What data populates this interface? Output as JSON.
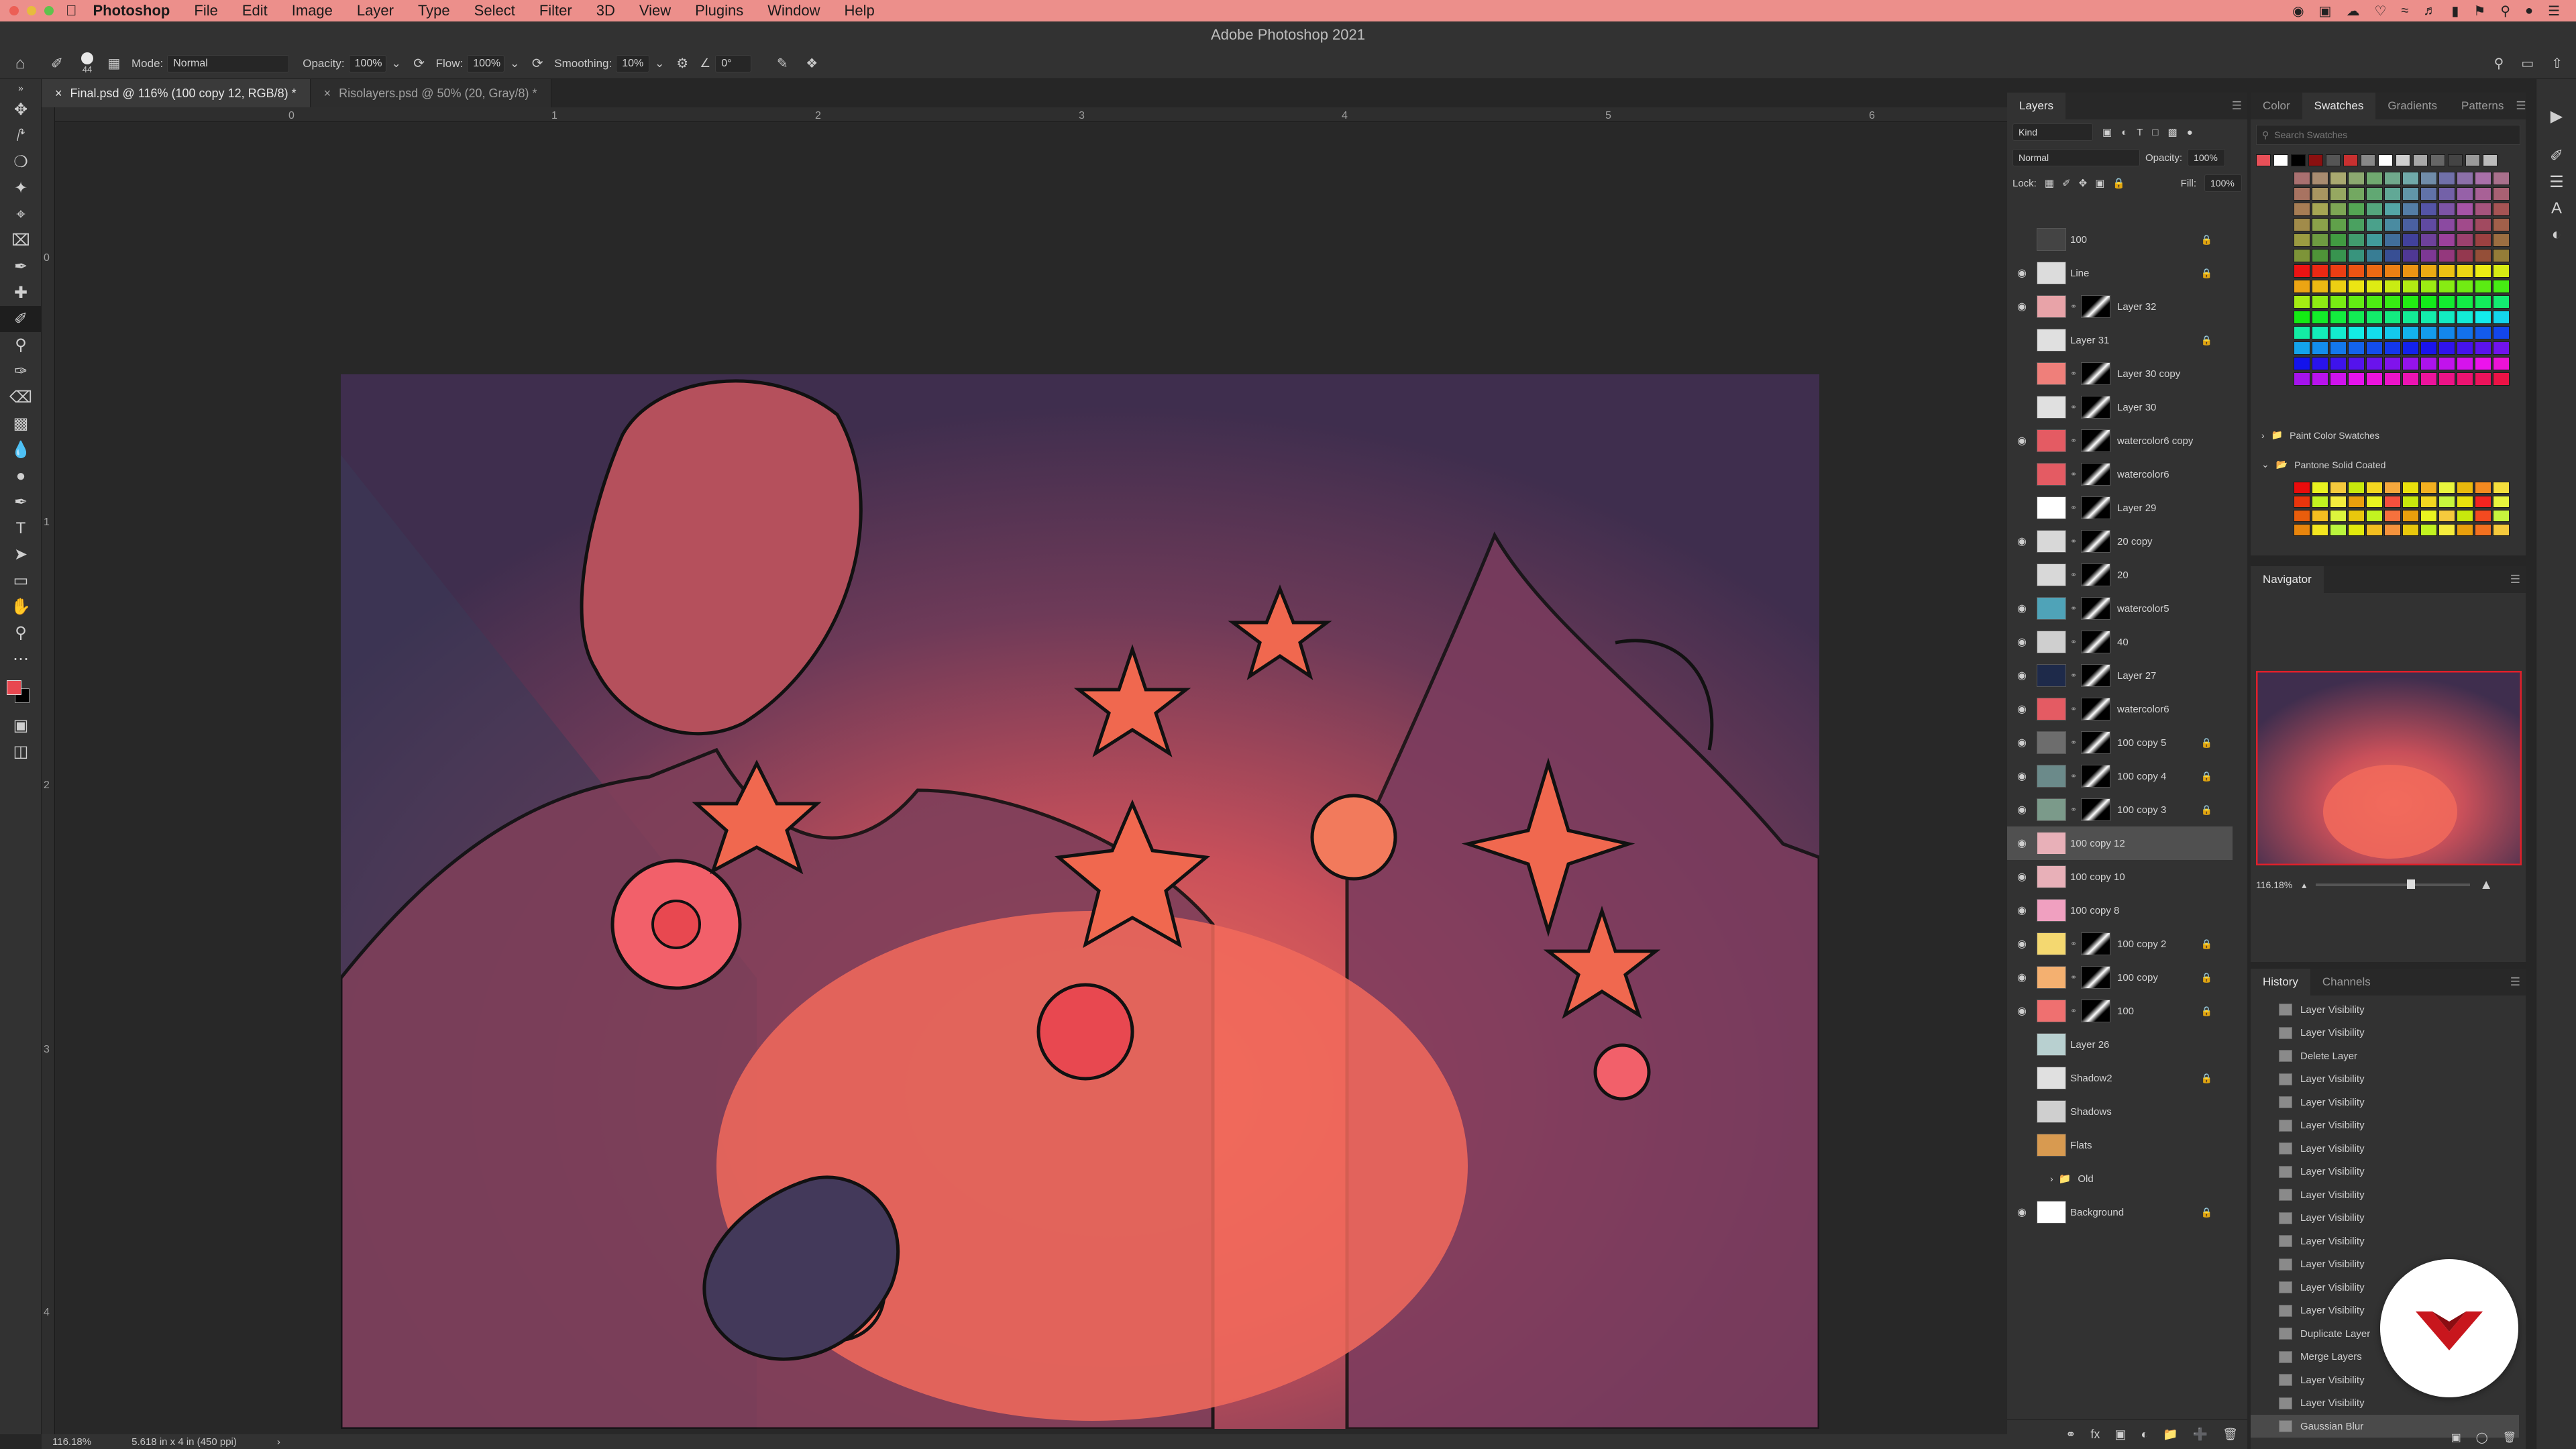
{
  "menubar": {
    "app": "Photoshop",
    "items": [
      "File",
      "Edit",
      "Image",
      "Layer",
      "Type",
      "Select",
      "Filter",
      "3D",
      "View",
      "Plugins",
      "Window",
      "Help"
    ]
  },
  "window_title": "Adobe Photoshop 2021",
  "options": {
    "brush_size": "44",
    "mode_label": "Mode:",
    "mode_value": "Normal",
    "opacity_label": "Opacity:",
    "opacity_value": "100%",
    "flow_label": "Flow:",
    "flow_value": "100%",
    "smoothing_label": "Smoothing:",
    "smoothing_value": "10%",
    "angle_value": "0°"
  },
  "tabs": [
    {
      "label": "Final.psd @ 116% (100 copy 12, RGB/8) *",
      "active": true
    },
    {
      "label": "Risolayers.psd @ 50% (20, Gray/8) *",
      "active": false
    }
  ],
  "rulers": {
    "h": [
      "0",
      "1",
      "2",
      "3",
      "4",
      "5",
      "6"
    ],
    "v": [
      "0",
      "1",
      "2",
      "3",
      "4"
    ]
  },
  "status": {
    "zoom": "116.18%",
    "doc_size": "5.618 in x 4 in (450 ppi)"
  },
  "layers_panel": {
    "tabs": [
      "Layers"
    ],
    "filter_kind": "Kind",
    "blend_mode": "Normal",
    "opacity_label": "Opacity:",
    "opacity_value": "100%",
    "lock_label": "Lock:",
    "fill_label": "Fill:",
    "fill_value": "100%",
    "layers": [
      {
        "name": "100",
        "visible": false,
        "locked": true,
        "thumb": "#444",
        "mask": false
      },
      {
        "name": "Line",
        "visible": true,
        "locked": true,
        "thumb": "#dcdcdc",
        "mask": false
      },
      {
        "name": "Layer 32",
        "visible": true,
        "locked": false,
        "thumb": "#e8a3a8",
        "mask": true
      },
      {
        "name": "Layer 31",
        "visible": false,
        "locked": true,
        "thumb": "#e0e0e0",
        "mask": false
      },
      {
        "name": "Layer 30 copy",
        "visible": false,
        "locked": false,
        "thumb": "#ef7f7a",
        "mask": true
      },
      {
        "name": "Layer 30",
        "visible": false,
        "locked": false,
        "thumb": "#e0e0e0",
        "mask": true
      },
      {
        "name": "watercolor6 copy",
        "visible": true,
        "locked": false,
        "thumb": "#e45b63",
        "mask": true
      },
      {
        "name": "watercolor6",
        "visible": false,
        "locked": false,
        "thumb": "#e45b63",
        "mask": true
      },
      {
        "name": "Layer 29",
        "visible": false,
        "locked": false,
        "thumb": "#ffffff",
        "mask": true
      },
      {
        "name": "20 copy",
        "visible": true,
        "locked": false,
        "thumb": "#d8d8d8",
        "mask": true
      },
      {
        "name": "20",
        "visible": false,
        "locked": false,
        "thumb": "#d8d8d8",
        "mask": true
      },
      {
        "name": "watercolor5",
        "visible": true,
        "locked": false,
        "thumb": "#4fa3b8",
        "mask": true
      },
      {
        "name": "40",
        "visible": true,
        "locked": false,
        "thumb": "#cfcfcf",
        "mask": true
      },
      {
        "name": "Layer 27",
        "visible": true,
        "locked": false,
        "thumb": "#1e2a4a",
        "mask": true
      },
      {
        "name": "watercolor6",
        "visible": true,
        "locked": false,
        "thumb": "#e45b63",
        "mask": true
      },
      {
        "name": "100 copy 5",
        "visible": true,
        "locked": true,
        "thumb": "#6d6d6d",
        "mask": true
      },
      {
        "name": "100 copy 4",
        "visible": true,
        "locked": true,
        "thumb": "#6b8a8a",
        "mask": true
      },
      {
        "name": "100 copy 3",
        "visible": true,
        "locked": true,
        "thumb": "#7b9a8a",
        "mask": true
      },
      {
        "name": "100 copy 12",
        "visible": true,
        "locked": false,
        "thumb": "#e8b0b8",
        "mask": false,
        "selected": true
      },
      {
        "name": "100 copy 10",
        "visible": true,
        "locked": false,
        "thumb": "#e8b0b8",
        "mask": false
      },
      {
        "name": "100 copy 8",
        "visible": true,
        "locked": false,
        "thumb": "#f0a0c0",
        "mask": false
      },
      {
        "name": "100 copy 2",
        "visible": true,
        "locked": true,
        "thumb": "#f4d870",
        "mask": true
      },
      {
        "name": "100 copy",
        "visible": true,
        "locked": true,
        "thumb": "#f4b070",
        "mask": true
      },
      {
        "name": "100",
        "visible": true,
        "locked": true,
        "thumb": "#ef7070",
        "mask": true
      },
      {
        "name": "Layer 26",
        "visible": false,
        "locked": false,
        "thumb": "#b8d0d0",
        "mask": false
      },
      {
        "name": "Shadow2",
        "visible": false,
        "locked": true,
        "thumb": "#e0e0e0",
        "mask": false
      },
      {
        "name": "Shadows",
        "visible": false,
        "locked": false,
        "thumb": "#cfcfcf",
        "mask": false
      },
      {
        "name": "Flats",
        "visible": false,
        "locked": false,
        "thumb": "#d89a50",
        "mask": false
      },
      {
        "name": "Old",
        "visible": false,
        "locked": false,
        "thumb": "",
        "mask": false,
        "group": true
      },
      {
        "name": "Background",
        "visible": true,
        "locked": true,
        "thumb": "#ffffff",
        "mask": false
      }
    ]
  },
  "swatches_panel": {
    "tabs": [
      "Color",
      "Swatches",
      "Gradients",
      "Patterns"
    ],
    "search_placeholder": "Search Swatches",
    "recent": [
      "#e85058",
      "#ffffff",
      "#000000",
      "#8a1010",
      "#555555",
      "#c83030",
      "#888888",
      "#ffffff",
      "#cfcfcf",
      "#a8a8a8",
      "#666666",
      "#444444",
      "#999999",
      "#bbbbbb"
    ],
    "groups": [
      "Paint Color Swatches",
      "Pantone Solid Coated"
    ]
  },
  "navigator": {
    "title": "Navigator",
    "zoom": "116.18%"
  },
  "history_panel": {
    "tabs": [
      "History",
      "Channels"
    ],
    "items": [
      "Layer Visibility",
      "Layer Visibility",
      "Delete Layer",
      "Layer Visibility",
      "Layer Visibility",
      "Layer Visibility",
      "Layer Visibility",
      "Layer Visibility",
      "Layer Visibility",
      "Layer Visibility",
      "Layer Visibility",
      "Layer Visibility",
      "Layer Visibility",
      "Layer Visibility",
      "Duplicate Layer",
      "Merge Layers",
      "Layer Visibility",
      "Layer Visibility",
      "Gaussian Blur"
    ],
    "selected_index": 18
  },
  "colors": {
    "menubar": "#ec8f8b",
    "foreground": "#e84850",
    "accent_badge": "#c8161d"
  }
}
